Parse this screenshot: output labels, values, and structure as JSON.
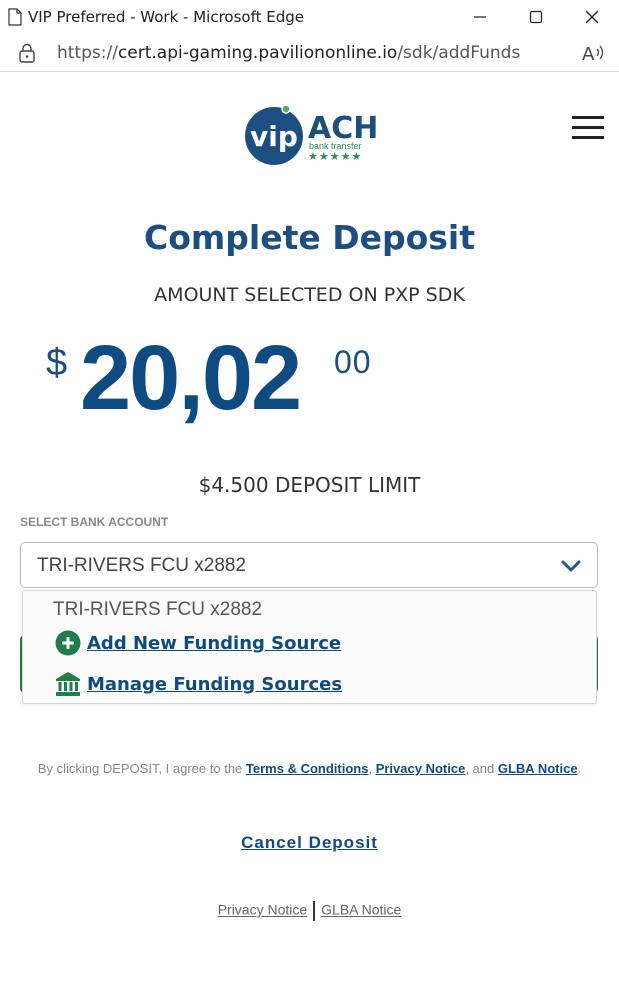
{
  "window": {
    "title": "VIP Preferred - Work - Microsoft Edge",
    "url_prefix": "https://",
    "url_host": "cert.api-gaming.paviliononline.io",
    "url_path": "/sdk/addFunds"
  },
  "logo": {
    "vip": "vip",
    "ach": "ACH",
    "tagline": "bank transfer",
    "stars": "★★★★★",
    "colors": {
      "navy": "#1c4f80",
      "green": "#2e8b57"
    }
  },
  "page": {
    "heading": "Complete Deposit",
    "subheading": "AMOUNT SELECTED ON PXP SDK",
    "currency_symbol": "$",
    "amount_main": "20,02",
    "amount_cents": "00",
    "limit": "$4.500 DEPOSIT LIMIT",
    "select_label": "SELECT BANK ACCOUNT",
    "selected_account": "TRI-RIVERS FCU x2882"
  },
  "dropdown": {
    "account_option": "TRI-RIVERS FCU x2882",
    "add_label": "Add New Funding Source",
    "manage_label": "Manage Funding Sources"
  },
  "terms": {
    "prefix": "By clicking DEPOSIT, I agree to the",
    "terms_link": "Terms & Conditions",
    "comma": ",",
    "privacy_link": "Privacy Notice",
    "and_text": ", and",
    "glba_link": "GLBA Notice",
    "period": "."
  },
  "cancel_label": "Cancel Deposit",
  "footer": {
    "privacy": "Privacy Notice",
    "glba": "GLBA Notice"
  },
  "colors": {
    "primary": "#0f4b83",
    "accent_green": "#1e7d4a"
  }
}
